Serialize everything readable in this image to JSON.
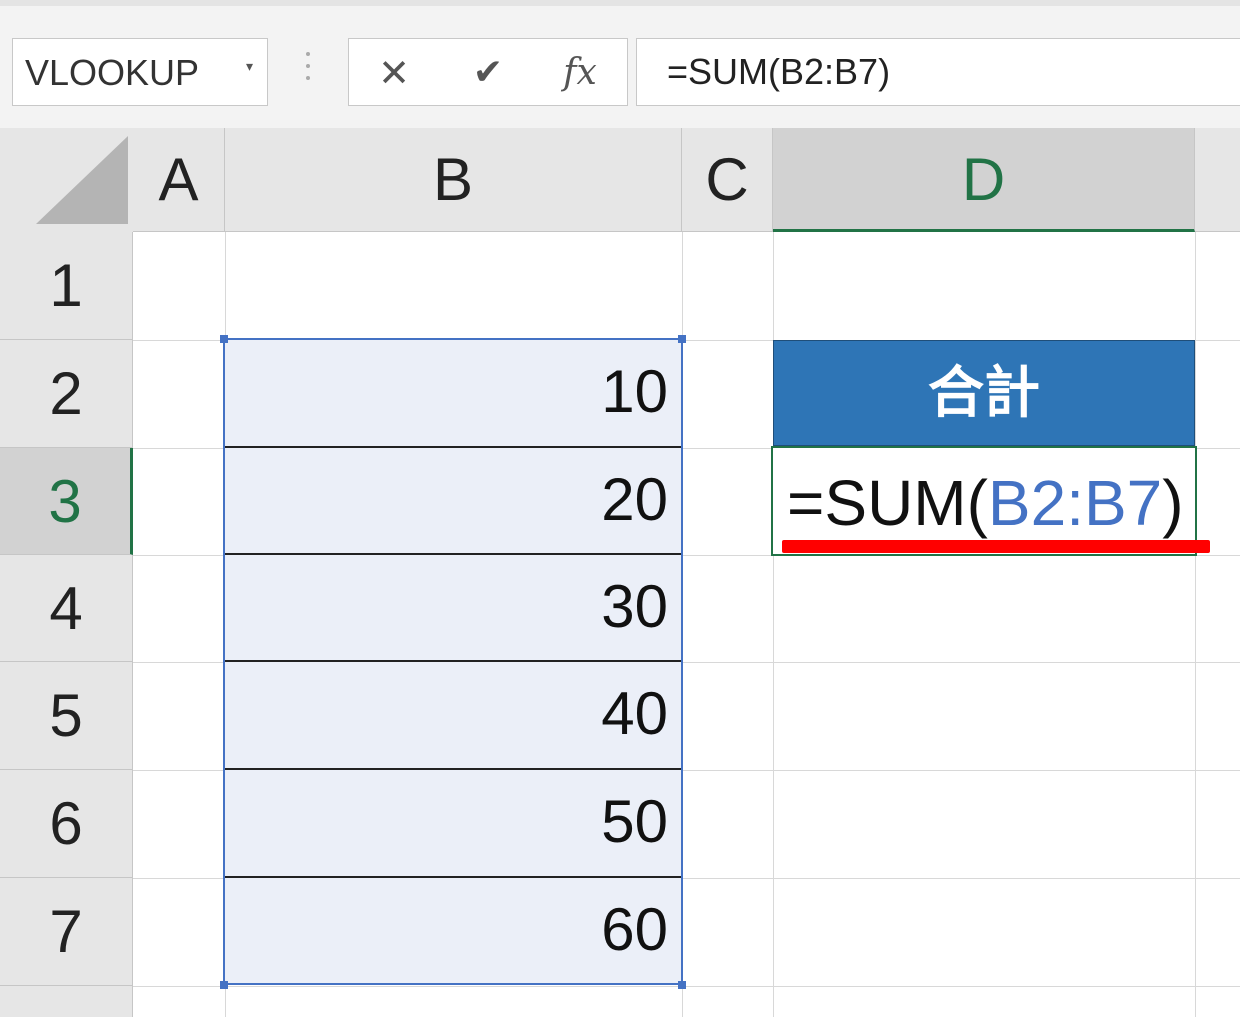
{
  "name_box": {
    "value": "VLOOKUP",
    "dropdown_icon": "chevron-down-icon"
  },
  "formula_buttons": {
    "cancel": "✕",
    "enter": "✔",
    "fx": "fx"
  },
  "formula_bar": {
    "value": "=SUM(B2:B7)"
  },
  "columns": [
    "A",
    "B",
    "C",
    "D"
  ],
  "rows": [
    "1",
    "2",
    "3",
    "4",
    "5",
    "6",
    "7"
  ],
  "cells": {
    "B2": "10",
    "B3": "20",
    "B4": "30",
    "B5": "40",
    "B6": "50",
    "B7": "60",
    "D2": "合計"
  },
  "active_cell": {
    "ref": "D3",
    "formula_prefix": "=SUM(",
    "formula_range": "B2:B7",
    "formula_suffix": ")"
  },
  "colors": {
    "header_fill": "#2e75b6",
    "selection_fill": "#ebeff8",
    "selection_border": "#4472c4",
    "active_border": "#217346",
    "underline": "#ff0000",
    "range_ref": "#4472c4"
  }
}
